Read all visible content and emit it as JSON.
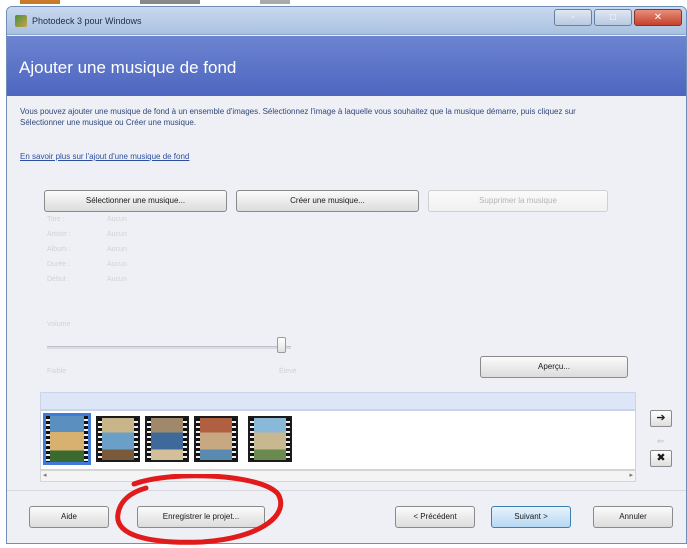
{
  "window": {
    "title": "Photodeck 3 pour Windows",
    "controls": {
      "minimize": "-",
      "maximize": "□",
      "close": "✕"
    }
  },
  "header": {
    "title": "Ajouter une musique de fond"
  },
  "main": {
    "description": "Vous pouvez ajouter une musique de fond à un ensemble d'images. Sélectionnez l'image à laquelle vous souhaitez que la musique démarre, puis cliquez sur Sélectionner une musique ou Créer une musique.",
    "learn_more_link": "En savoir plus sur l'ajout d'une musique de fond",
    "buttons": {
      "select_music": "Sélectionner une musique...",
      "create_music": "Créer une musique...",
      "remove_music": "Supprimer la musique"
    },
    "music_info": [
      {
        "key": "Titre :",
        "value": "Aucun"
      },
      {
        "key": "Artiste :",
        "value": "Aucun"
      },
      {
        "key": "Album :",
        "value": "Aucun"
      },
      {
        "key": "Durée :",
        "value": "Aucun"
      },
      {
        "key": "Début :",
        "value": "Aucun"
      }
    ],
    "volume": {
      "label": "Volume",
      "min_label": "Faible",
      "max_label": "Élevé",
      "level": 0.98
    },
    "preview_button": "Aperçu..."
  },
  "filmstrip": {
    "thumbnails": [
      {
        "name": "photo-1",
        "selected": true,
        "colors": [
          "#5a8fc0",
          "#d8b070",
          "#3a6a30"
        ]
      },
      {
        "name": "photo-2",
        "selected": false,
        "colors": [
          "#c9b58a",
          "#6aa0c8",
          "#7a5a3a"
        ]
      },
      {
        "name": "photo-3",
        "selected": false,
        "colors": [
          "#a0886a",
          "#3d6a9a",
          "#d3c09a"
        ]
      },
      {
        "name": "photo-4",
        "selected": false,
        "colors": [
          "#b06040",
          "#c8a880",
          "#5a8ab0"
        ]
      },
      {
        "name": "photo-5",
        "selected": false,
        "colors": [
          "#8ab8d8",
          "#c8b890",
          "#6a8a50"
        ]
      }
    ],
    "side_buttons": {
      "move_right": "➔",
      "move_dim": "⇐",
      "remove": "✖"
    },
    "scroll_left": "◂",
    "scroll_right": "▸"
  },
  "footer": {
    "help": "Aide",
    "save_project": "Enregistrer le projet...",
    "previous": "< Précédent",
    "next": "Suivant >",
    "cancel": "Annuler"
  },
  "colors": {
    "banner": "#5570c8",
    "annotation": "#e11b1b",
    "accent": "#3e7ad6"
  }
}
